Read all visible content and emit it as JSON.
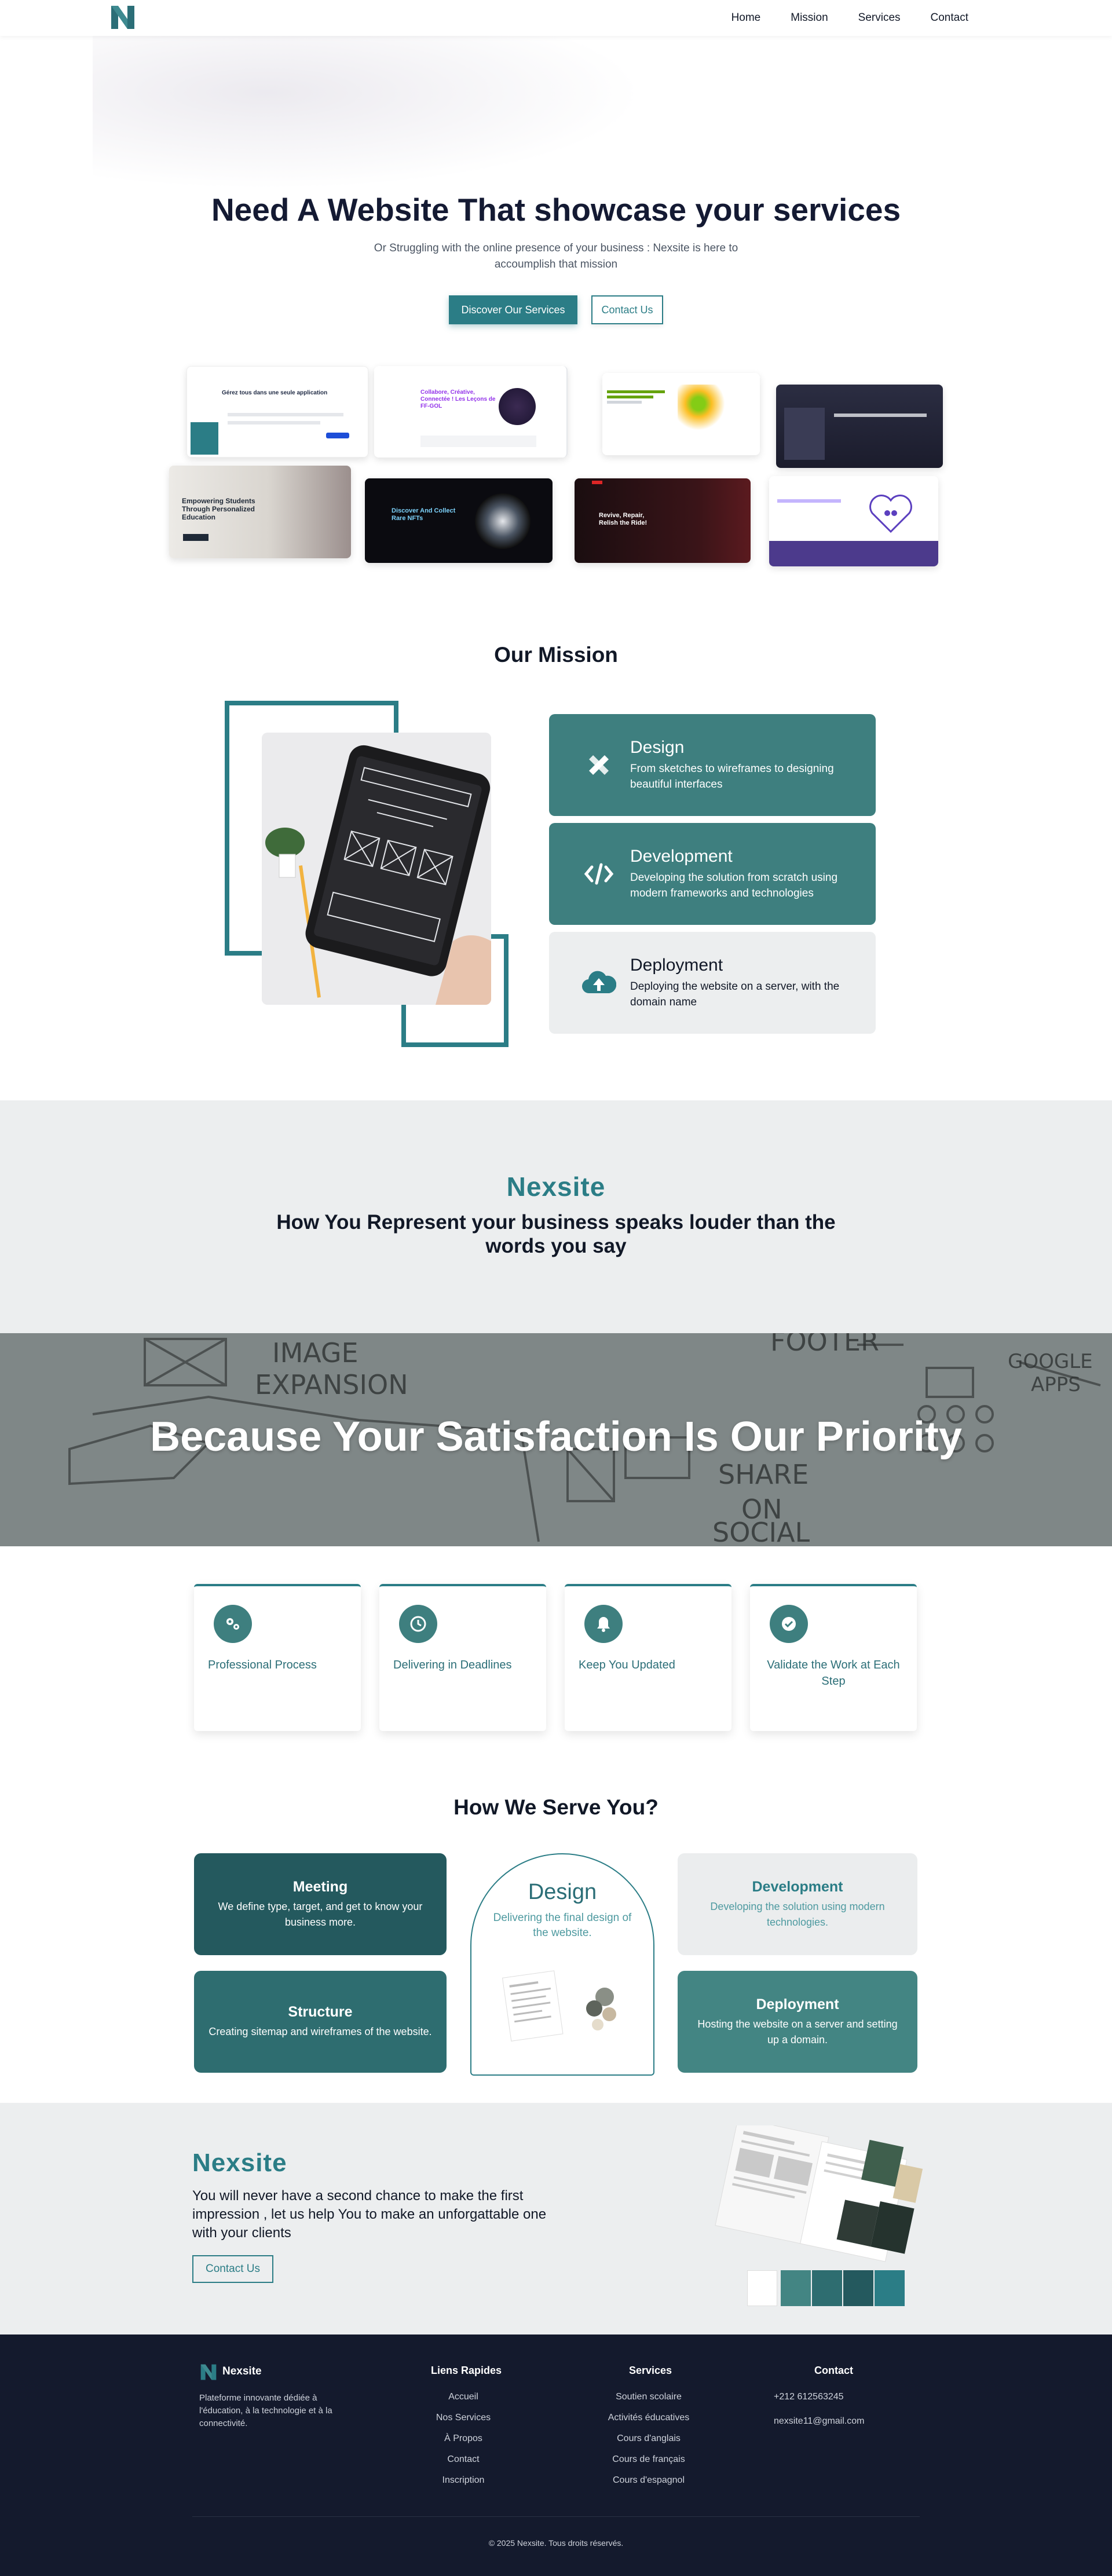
{
  "nav": {
    "links": [
      "Home",
      "Mission",
      "Services",
      "Contact"
    ]
  },
  "hero": {
    "title": "Need A Website That showcase your services",
    "subtitle": "Or Struggling with the online presence of your business : Nexsite is here to accoumplish that mission",
    "primary_btn": "Discover Our Services",
    "secondary_btn": "Contact Us"
  },
  "portfolio": {
    "thumb_texts": [
      "Gérez tous dans une seule application",
      "Collabore, Créative, Connectée ! Les Leçons de FF-GOL",
      "Empowering Students Through Personalized Education",
      "Discover And Collect Rare NFTs",
      "Revive, Repair, Relish the Ride!"
    ]
  },
  "mission": {
    "title": "Our Mission",
    "cards": [
      {
        "title": "Design",
        "desc": "From sketches to wireframes to designing beautiful interfaces",
        "icon": "pencil-ruler-icon"
      },
      {
        "title": "Development",
        "desc": "Developing the solution from scratch using modern frameworks and technologies",
        "icon": "code-icon"
      },
      {
        "title": "Deployment",
        "desc": "Deploying the website on a server, with the domain name",
        "icon": "cloud-upload-icon"
      }
    ]
  },
  "band": {
    "brand": "Nexsite",
    "text": "How You Represent your business speaks louder than the words you say"
  },
  "banner": {
    "title": "Because Your Satisfaction Is Our Priority"
  },
  "features": [
    {
      "label": "Professional Process",
      "icon": "gears-icon"
    },
    {
      "label": "Delivering in Deadlines",
      "icon": "clock-icon"
    },
    {
      "label": "Keep You Updated",
      "icon": "bell-icon"
    },
    {
      "label": "Validate the Work at Each Step",
      "icon": "check-circle-icon"
    }
  ],
  "serve": {
    "title": "How We Serve You?",
    "meeting": {
      "title": "Meeting",
      "desc": "We define type, target, and get to know your business more."
    },
    "structure": {
      "title": "Structure",
      "desc": "Creating sitemap and wireframes of the website."
    },
    "design": {
      "title": "Design",
      "desc": "Delivering the final design of the website."
    },
    "development": {
      "title": "Development",
      "desc": "Developing the solution using modern technologies."
    },
    "deployment": {
      "title": "Deployment",
      "desc": "Hosting the website on a server and setting up a domain."
    }
  },
  "cta": {
    "brand": "Nexsite",
    "text": "You will never have a second chance to make the first impression , let us help You to make an unforgattable one with your clients",
    "button": "Contact Us",
    "swatches": [
      "#ffffff",
      "#438583",
      "#2e6d70",
      "#24595e",
      "#2b7d86"
    ]
  },
  "footer": {
    "brand": "Nexsite",
    "about": "Plateforme innovante dédiée à l'éducation, à la technologie et à la connectivité.",
    "quick_title": "Liens Rapides",
    "quick_links": [
      "Accueil",
      "Nos Services",
      "À Propos",
      "Contact",
      "Inscription"
    ],
    "services_title": "Services",
    "services_links": [
      "Soutien scolaire",
      "Activités éducatives",
      "Cours d'anglais",
      "Cours de français",
      "Cours d'espagnol"
    ],
    "contact_title": "Contact",
    "phone": "+212 612563245",
    "email": "nexsite11@gmail.com",
    "copyright": "© 2025 Nexsite. Tous droits réservés."
  },
  "colors": {
    "accent": "#2b7d86",
    "dark_teal": "#24595e",
    "footer_bg": "#141a2d",
    "band_bg": "#eceeef"
  }
}
